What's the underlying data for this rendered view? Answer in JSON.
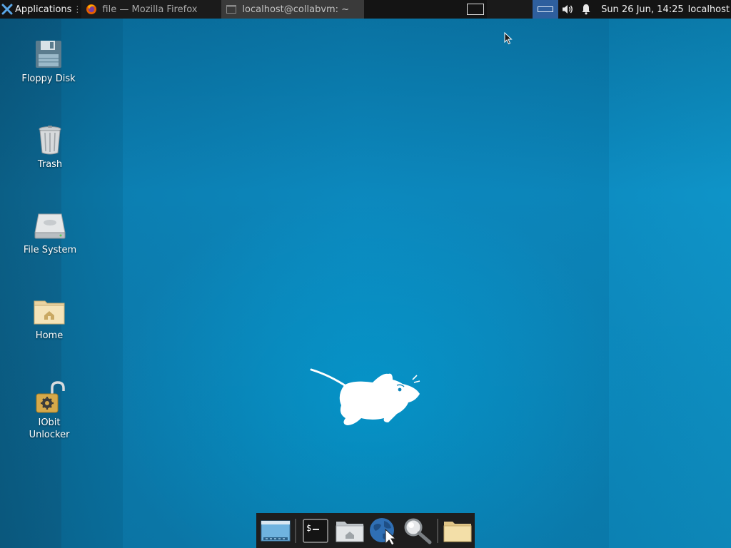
{
  "top_panel": {
    "applications_label": "Applications",
    "tasks": [
      {
        "label": "file — Mozilla Firefox",
        "icon": "firefox-icon"
      },
      {
        "label": "localhost@collabvm: ~",
        "icon": "terminal-window-icon"
      }
    ],
    "clock": "Sun 26 Jun, 14:25",
    "hostname": "localhost"
  },
  "desktop_icons": [
    {
      "label": "Floppy Disk",
      "icon": "floppy-disk-icon"
    },
    {
      "label": "Trash",
      "icon": "trash-icon"
    },
    {
      "label": "File System",
      "icon": "hard-drive-icon"
    },
    {
      "label": "Home",
      "icon": "home-folder-icon"
    },
    {
      "label": "IObit Unlocker",
      "icon": "unlocker-padlock-icon"
    }
  ],
  "dock": {
    "items": [
      "show-desktop-icon",
      "terminal-icon",
      "home-folder-icon",
      "web-browser-icon",
      "app-finder-icon",
      "file-manager-icon"
    ]
  },
  "colors": {
    "panel": "#141414",
    "active_workspace": "#2e5f9e",
    "wallpaper": "#0c86bb"
  }
}
